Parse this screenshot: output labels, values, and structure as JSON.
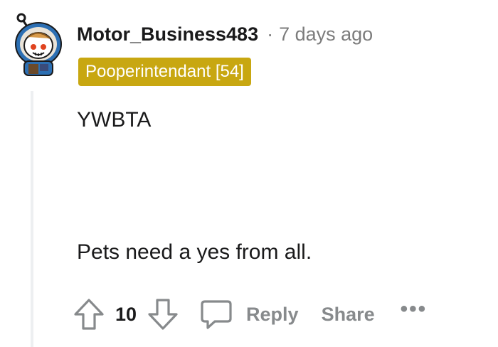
{
  "comment": {
    "author": "Motor_Business483",
    "separator": "·",
    "timestamp": "7 days ago",
    "flair": "Pooperintendant [54]",
    "flair_color": "#c8a711",
    "body_lines": [
      "YWBTA",
      "Pets need a yes from all."
    ]
  },
  "actions": {
    "upvote_icon": "arrow-up-icon",
    "score": "10",
    "downvote_icon": "arrow-down-icon",
    "reply_icon": "speech-bubble-icon",
    "reply_label": "Reply",
    "share_label": "Share",
    "more_label": "•••"
  },
  "colors": {
    "text": "#1a1a1b",
    "muted": "#878a8c",
    "thread_line": "#edeff1"
  }
}
